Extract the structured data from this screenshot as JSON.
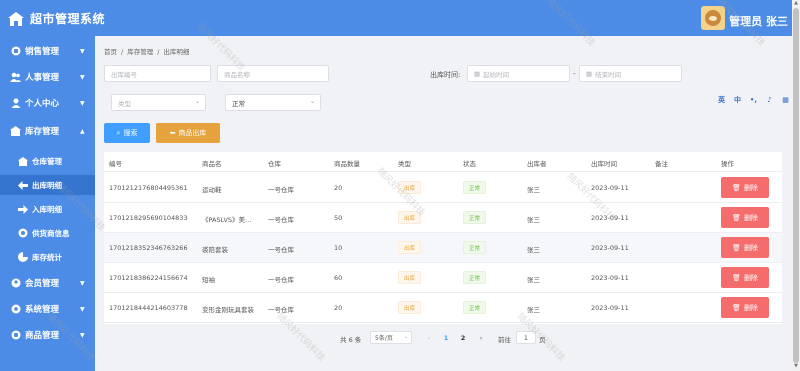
{
  "header": {
    "title": "超市管理系统",
    "user_name": "管理员 张三"
  },
  "sidebar": {
    "items": [
      {
        "label": "销售管理",
        "icon": "grid-icon"
      },
      {
        "label": "人事管理",
        "icon": "people-icon"
      },
      {
        "label": "个人中心",
        "icon": "person-icon"
      },
      {
        "label": "库存管理",
        "icon": "store-icon"
      }
    ],
    "sub_items": [
      {
        "label": "仓库管理",
        "icon": "warehouse-icon"
      },
      {
        "label": "出库明细",
        "icon": "arrow-left-icon"
      },
      {
        "label": "入库明细",
        "icon": "arrow-right-icon"
      },
      {
        "label": "供货商信息",
        "icon": "supplier-icon"
      },
      {
        "label": "库存统计",
        "icon": "chart-icon"
      }
    ],
    "bottom_items": [
      {
        "label": "会员管理",
        "icon": "member-icon"
      },
      {
        "label": "系统管理",
        "icon": "gear-icon"
      },
      {
        "label": "商品管理",
        "icon": "goods-icon"
      }
    ]
  },
  "breadcrumb": [
    "首页",
    "/",
    "库存管理",
    "/",
    "出库明细"
  ],
  "filters": {
    "order_placeholder": "出库编号",
    "product_placeholder": "商品名称",
    "time_label": "出库时间:",
    "start_placeholder": "起始时间",
    "separator": "-",
    "end_placeholder": "结束时间",
    "type_placeholder": "类型",
    "status_value": "正常"
  },
  "buttons": {
    "search": "搜索",
    "outbound": "商品出库",
    "delete": "删除"
  },
  "toolbar_icons": [
    "英",
    "中",
    "•,",
    "♪",
    "▦"
  ],
  "table": {
    "headers": [
      "编号",
      "商品名",
      "仓库",
      "商品数量",
      "类型",
      "状态",
      "出库者",
      "出库时间",
      "备注",
      "操作"
    ],
    "rows": [
      {
        "id": "1701212176804495361",
        "name": "运动鞋",
        "warehouse": "一号仓库",
        "qty": "20",
        "type": "出库",
        "status": "正常",
        "user": "张三",
        "time": "2023-09-11",
        "note": ""
      },
      {
        "id": "1701218295690104833",
        "name": "《PASLVS》美...",
        "warehouse": "一号仓库",
        "qty": "50",
        "type": "出库",
        "status": "正常",
        "user": "张三",
        "time": "2023-09-11",
        "note": ""
      },
      {
        "id": "1701218352346763266",
        "name": "裘陪套装",
        "warehouse": "一号仓库",
        "qty": "10",
        "type": "出库",
        "status": "正常",
        "user": "张三",
        "time": "2023-09-11",
        "note": ""
      },
      {
        "id": "1701218386224156674",
        "name": "短袖",
        "warehouse": "一号仓库",
        "qty": "60",
        "type": "出库",
        "status": "正常",
        "user": "张三",
        "time": "2023-09-11",
        "note": ""
      },
      {
        "id": "1701218444214603778",
        "name": "变形金刚玩具套装",
        "warehouse": "一号仓库",
        "qty": "20",
        "type": "出库",
        "status": "正常",
        "user": "张三",
        "time": "2023-09-11",
        "note": ""
      }
    ]
  },
  "pagination": {
    "total": "共 6 条",
    "page_size": "5条/页",
    "prev": "‹",
    "page1": "1",
    "page2": "2",
    "next": "›",
    "goto": "前往",
    "goto_value": "1",
    "page_suffix": "页"
  },
  "watermark": "随风好代码科技"
}
